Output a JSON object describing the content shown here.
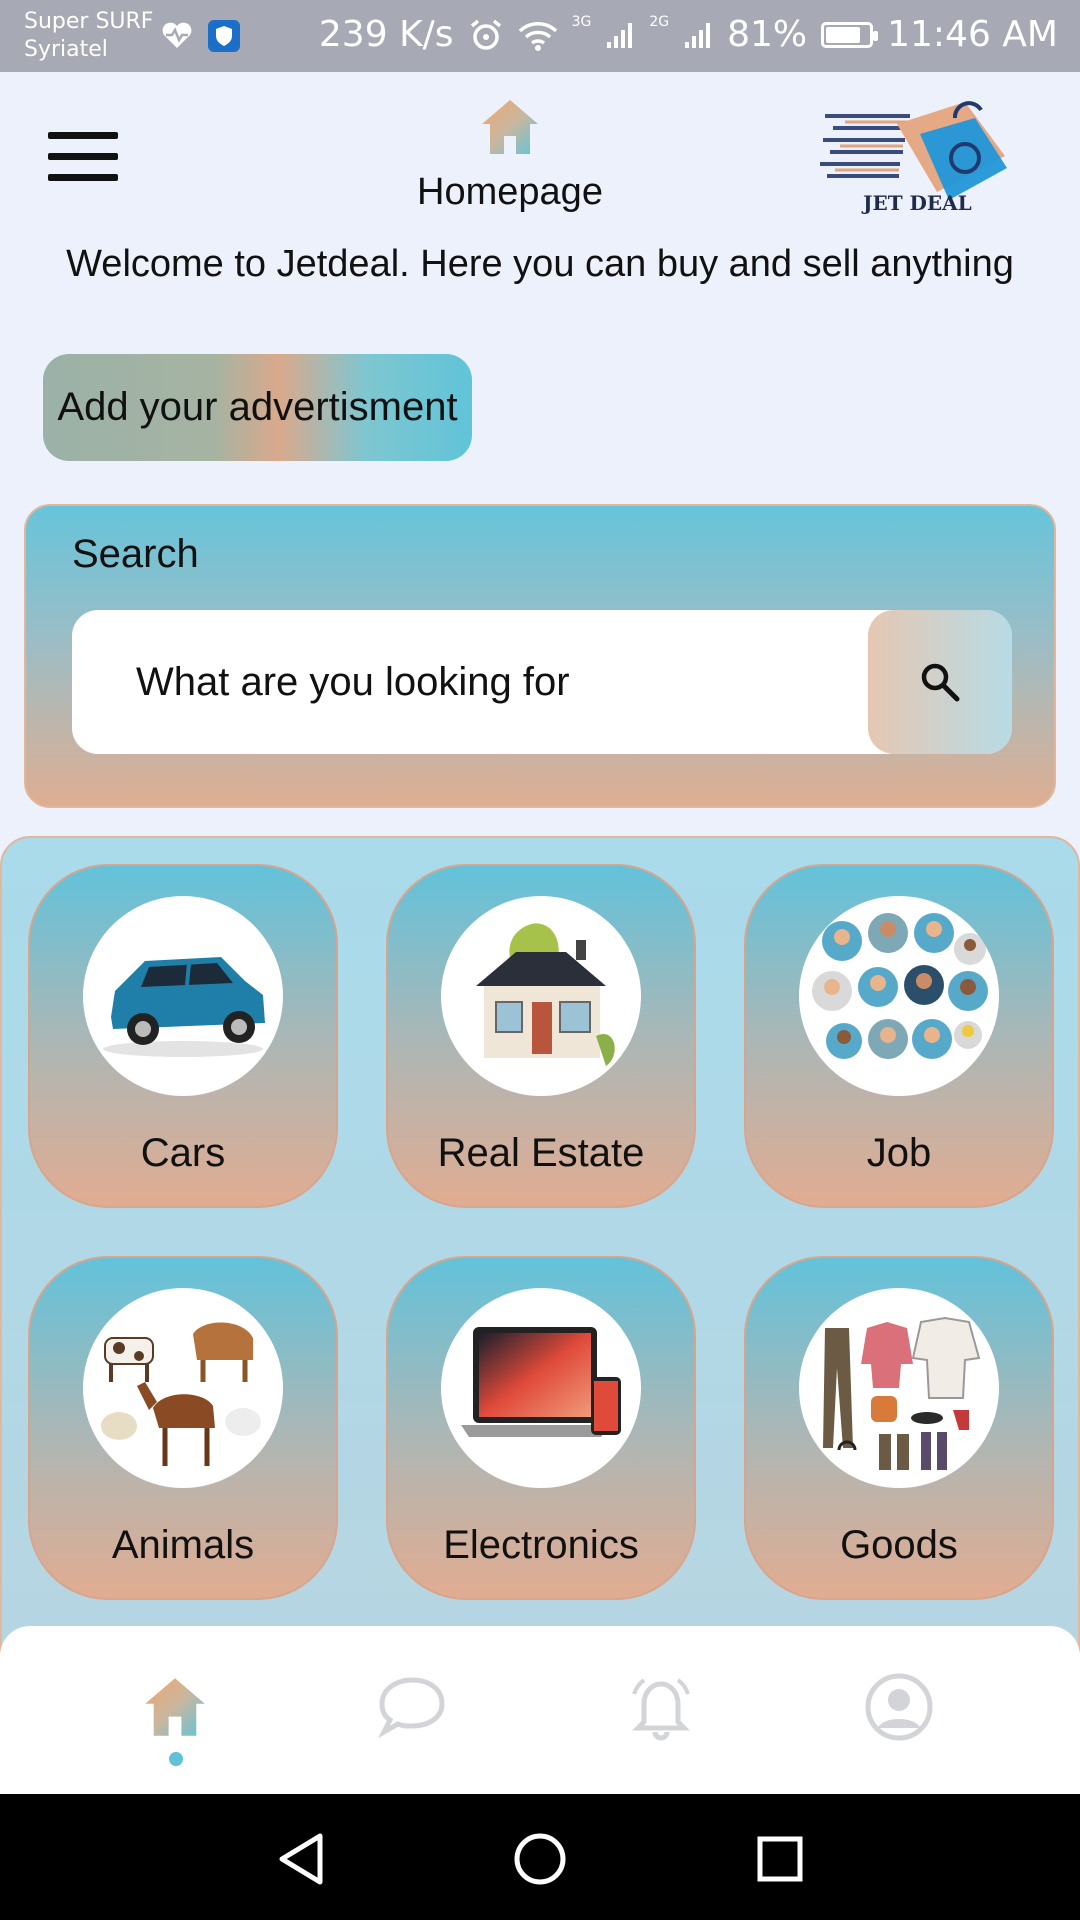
{
  "status_bar": {
    "carrier_line1": "Super SURF",
    "carrier_line2": "Syriatel",
    "speed": "239 K/s",
    "net1": "3G",
    "net2": "2G",
    "battery": "81%",
    "battery_level": 0.81,
    "time": "11:46 AM"
  },
  "header": {
    "title": "Homepage",
    "menu_icon": "hamburger-menu-icon",
    "home_icon": "home-icon",
    "logo_text": "JET DEAL"
  },
  "welcome_text": "Welcome to Jetdeal. Here you can buy and sell anything",
  "add_button_label": "Add your advertisment",
  "search": {
    "label": "Search",
    "placeholder": "What are you looking for",
    "button_icon": "search-icon"
  },
  "categories": [
    {
      "name": "Cars",
      "icon": "car-image"
    },
    {
      "name": "Real Estate",
      "icon": "house-image"
    },
    {
      "name": "Job",
      "icon": "people-image"
    },
    {
      "name": "Animals",
      "icon": "animals-image"
    },
    {
      "name": "Electronics",
      "icon": "laptop-image"
    },
    {
      "name": "Goods",
      "icon": "clothing-image"
    }
  ],
  "bottom_nav": [
    {
      "icon": "home-icon",
      "active": true
    },
    {
      "icon": "chat-icon",
      "active": false
    },
    {
      "icon": "bell-icon",
      "active": false
    },
    {
      "icon": "profile-icon",
      "active": false
    }
  ],
  "colors": {
    "accent_teal": "#62c2da",
    "accent_peach": "#e1ac91",
    "background": "#edf1fb"
  }
}
